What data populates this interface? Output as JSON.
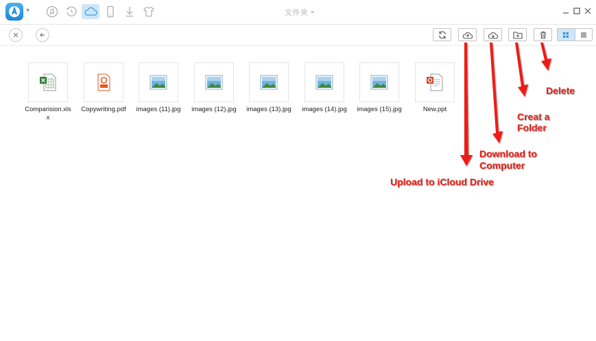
{
  "titlebar": {
    "device_name": "文件夹",
    "nav_icons": [
      "music-icon",
      "history-icon",
      "cloud-icon",
      "phone-icon",
      "download-icon",
      "tshirt-icon"
    ]
  },
  "files": [
    {
      "name": "Comparision.xlsx",
      "kind": "xlsx"
    },
    {
      "name": "Copywriting.pdf",
      "kind": "pdf"
    },
    {
      "name": "images (11).jpg",
      "kind": "jpg"
    },
    {
      "name": "images (12).jpg",
      "kind": "jpg"
    },
    {
      "name": "images (13).jpg",
      "kind": "jpg"
    },
    {
      "name": "images (14).jpg",
      "kind": "jpg"
    },
    {
      "name": "images (15).jpg",
      "kind": "jpg"
    },
    {
      "name": "New.ppt",
      "kind": "ppt"
    }
  ],
  "annotations": {
    "delete": "Delete",
    "create_folder_1": "Creat a",
    "create_folder_2": "Folder",
    "download_1": "Download to",
    "download_2": "Computer",
    "upload": "Upload to iCloud Drive"
  },
  "colors": {
    "accent": "#1f86d6",
    "active_bg": "#cfe6f7",
    "annotation_red": "#e8231a"
  }
}
